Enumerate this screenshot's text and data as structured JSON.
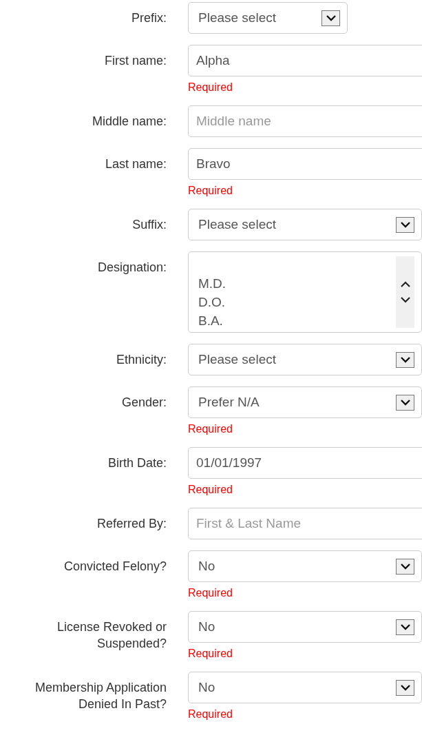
{
  "fields": [
    {
      "label": "Prefix:",
      "kind": "select",
      "value": "Please select",
      "narrow": true
    },
    {
      "label": "First name:",
      "kind": "text",
      "value": "Alpha",
      "error": "Required"
    },
    {
      "label": "Middle name:",
      "kind": "text",
      "placeholder": "Middle name"
    },
    {
      "label": "Last name:",
      "kind": "text",
      "value": "Bravo",
      "error": "Required"
    },
    {
      "label": "Suffix:",
      "kind": "select",
      "value": "Please select"
    },
    {
      "label": "Designation:",
      "kind": "listbox",
      "options": [
        "M.D.",
        "D.O.",
        "B.A."
      ]
    },
    {
      "label": "Ethnicity:",
      "kind": "select",
      "value": "Please select"
    },
    {
      "label": "Gender:",
      "kind": "select",
      "value": "Prefer N/A",
      "error": "Required"
    },
    {
      "label": "Birth Date:",
      "kind": "text",
      "value": "01/01/1997",
      "error": "Required"
    },
    {
      "label": "Referred By:",
      "kind": "text",
      "placeholder": "First & Last Name"
    },
    {
      "label": "Convicted Felony?",
      "kind": "select",
      "value": "No",
      "error": "Required"
    },
    {
      "label": "License Revoked or Suspended?",
      "kind": "select",
      "value": "No",
      "error": "Required"
    },
    {
      "label": "Membership Application Denied In Past?",
      "kind": "select",
      "value": "No",
      "error": "Required"
    }
  ]
}
